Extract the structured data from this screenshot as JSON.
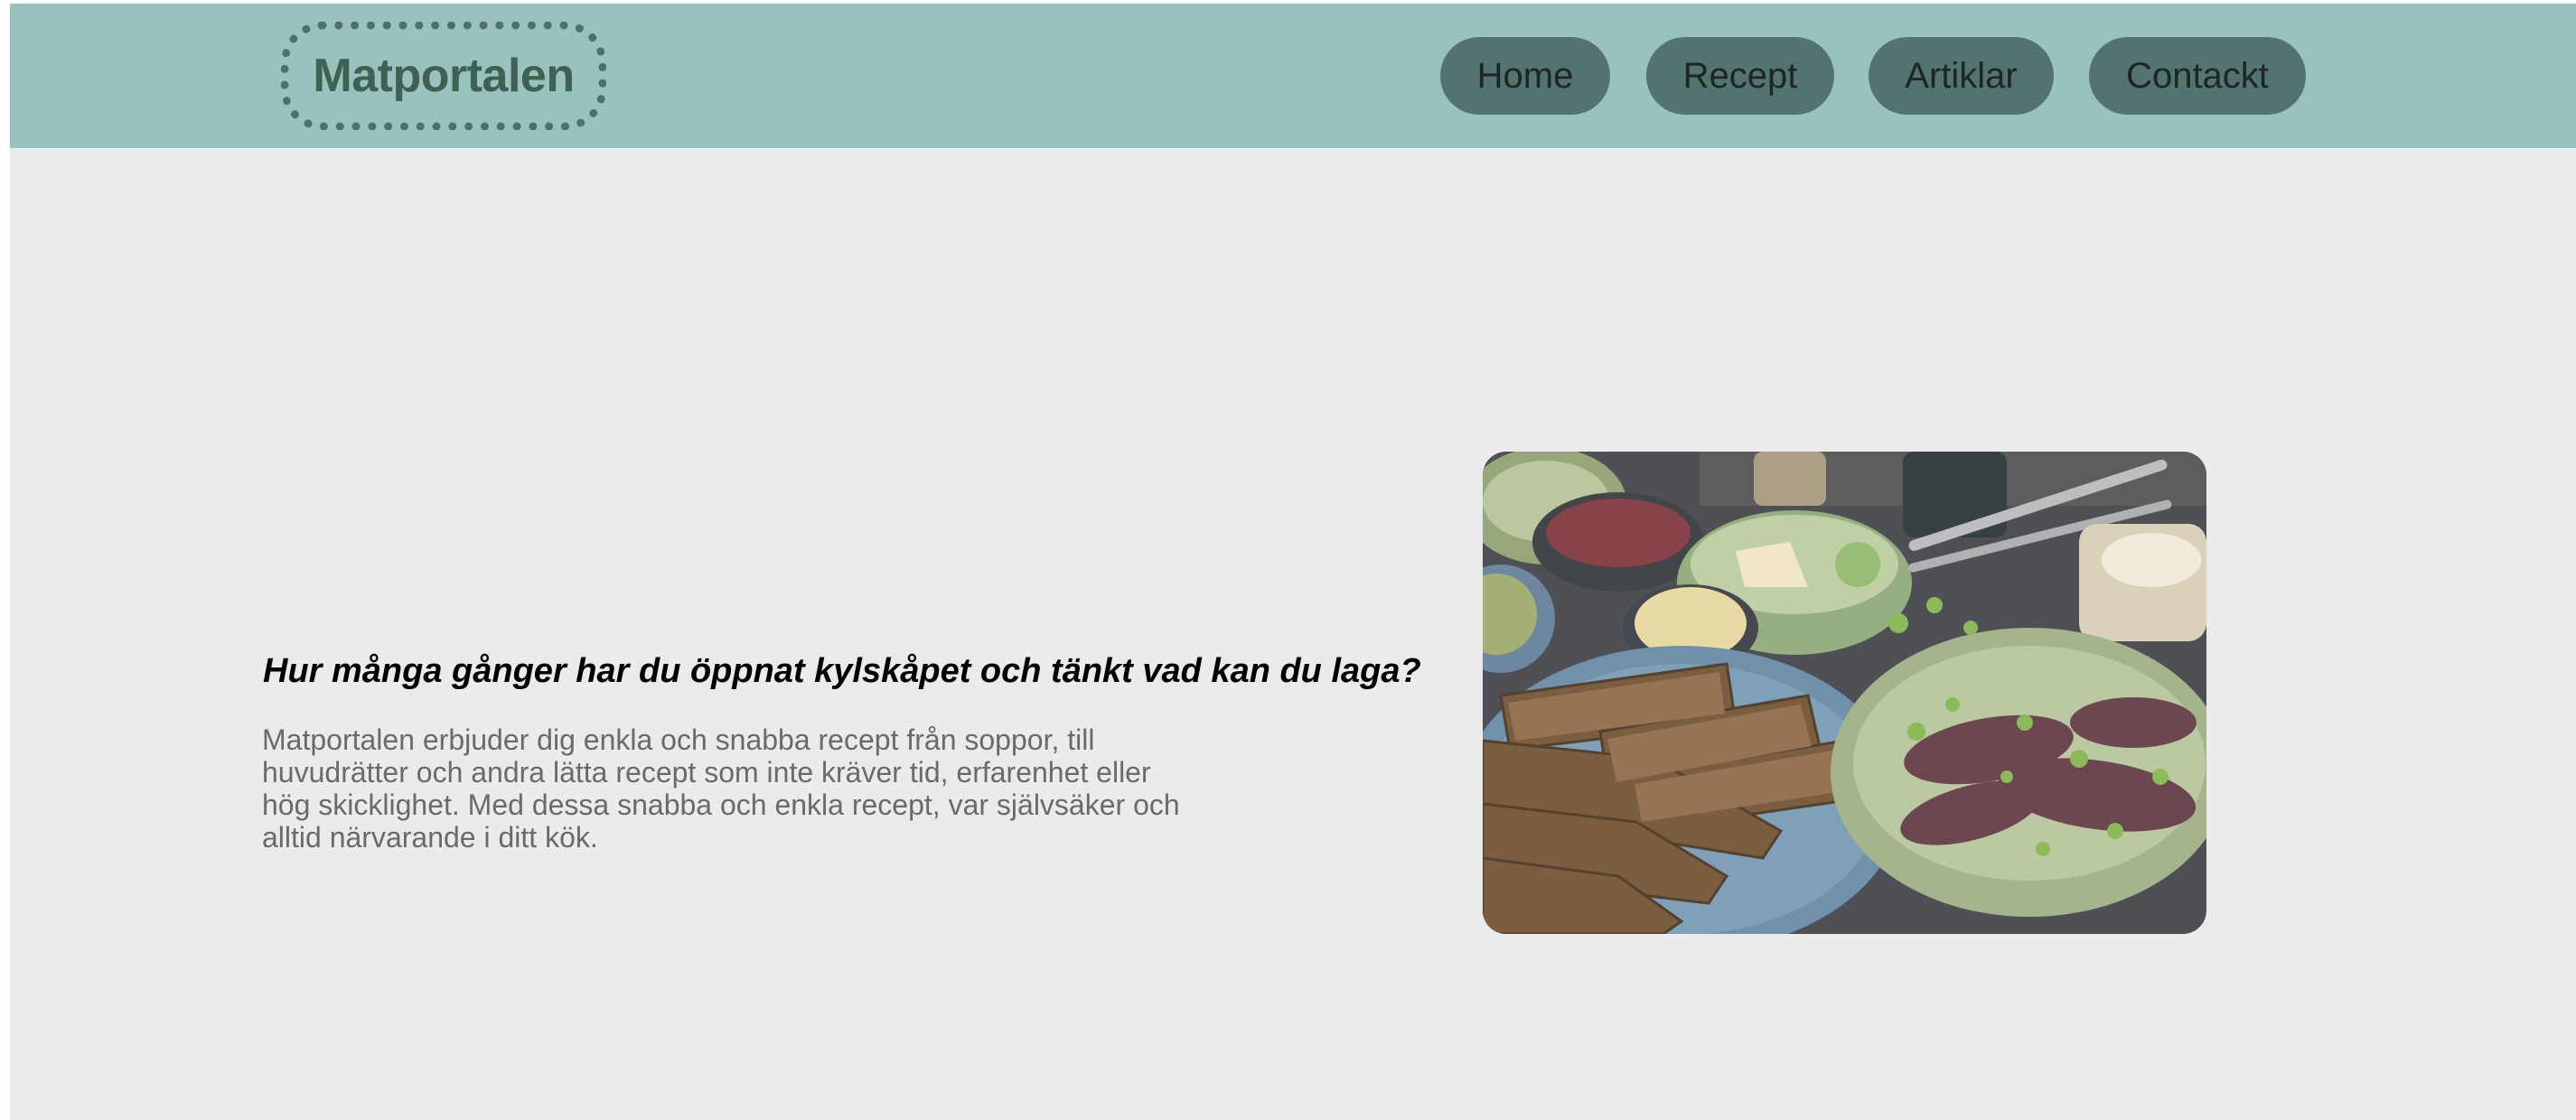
{
  "header": {
    "logo_text": "Matportalen",
    "nav": [
      {
        "label": "Home"
      },
      {
        "label": "Recept"
      },
      {
        "label": "Artiklar"
      },
      {
        "label": "Contackt"
      }
    ]
  },
  "hero": {
    "heading": "Hur många gånger har du öppnat kylskåpet och tänkt vad kan du laga?",
    "body": "Matportalen erbjuder dig enkla och snabba recept från soppor, till huvudrätter och andra lätta recept som inte kräver tid, erfarenhet eller hög skicklighet. Med dessa snabba och enkla recept, var självsäker och alltid närvarande i ditt kök."
  },
  "colors": {
    "header_bg": "#97c2bd",
    "nav_button_bg": "#537370",
    "page_bg": "#ebebeb",
    "logo_text": "#3f6152"
  }
}
